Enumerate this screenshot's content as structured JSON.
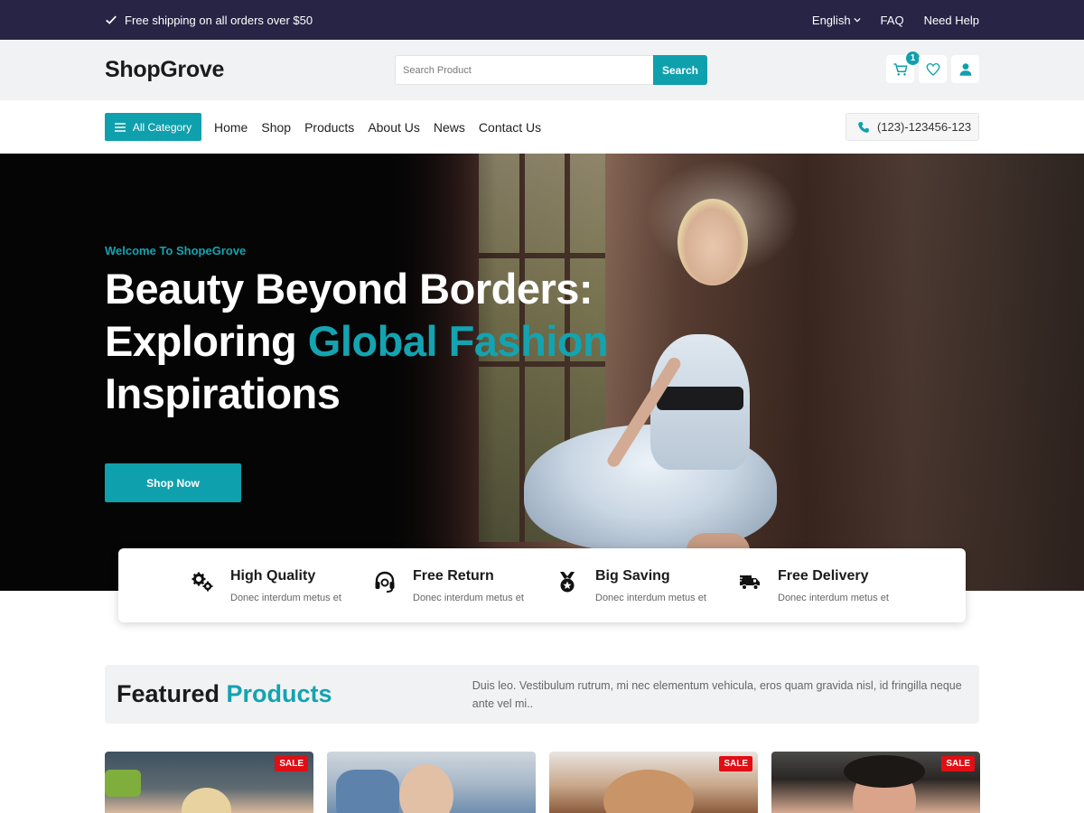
{
  "topbar": {
    "shipping_text": "Free shipping on all orders over $50",
    "language": "English",
    "faq": "FAQ",
    "help": "Need Help"
  },
  "header": {
    "logo": "ShopGrove",
    "search_placeholder": "Search Product",
    "search_button": "Search",
    "cart_count": "1"
  },
  "nav": {
    "all_category": "All Category",
    "items": [
      "Home",
      "Shop",
      "Products",
      "About Us",
      "News",
      "Contact Us"
    ],
    "phone": "(123)-123456-123"
  },
  "hero": {
    "welcome": "Welcome To ShopeGrove",
    "line1": "Beauty Beyond Borders:",
    "line2_plain": "Exploring ",
    "line2_accent": "Global Fashion",
    "line3": "Inspirations",
    "cta": "Shop Now"
  },
  "features": [
    {
      "title": "High Quality",
      "subtitle": "Donec interdum metus et",
      "icon": "gears-icon"
    },
    {
      "title": "Free Return",
      "subtitle": "Donec interdum metus et",
      "icon": "headset-icon"
    },
    {
      "title": "Big Saving",
      "subtitle": "Donec interdum metus et",
      "icon": "medal-icon"
    },
    {
      "title": "Free Delivery",
      "subtitle": "Donec interdum metus et",
      "icon": "truck-icon"
    }
  ],
  "featured": {
    "title_plain": "Featured ",
    "title_accent": "Products",
    "description": "Duis leo. Vestibulum rutrum, mi nec elementum vehicula, eros quam gravida nisl, id fringilla neque ante vel mi.."
  },
  "products": [
    {
      "badge": "SALE"
    },
    {
      "badge": ""
    },
    {
      "badge": "SALE"
    },
    {
      "badge": "SALE"
    }
  ],
  "colors": {
    "accent": "#0fa0ad",
    "topbar_bg": "#272446",
    "sale_badge": "#e10e14"
  }
}
